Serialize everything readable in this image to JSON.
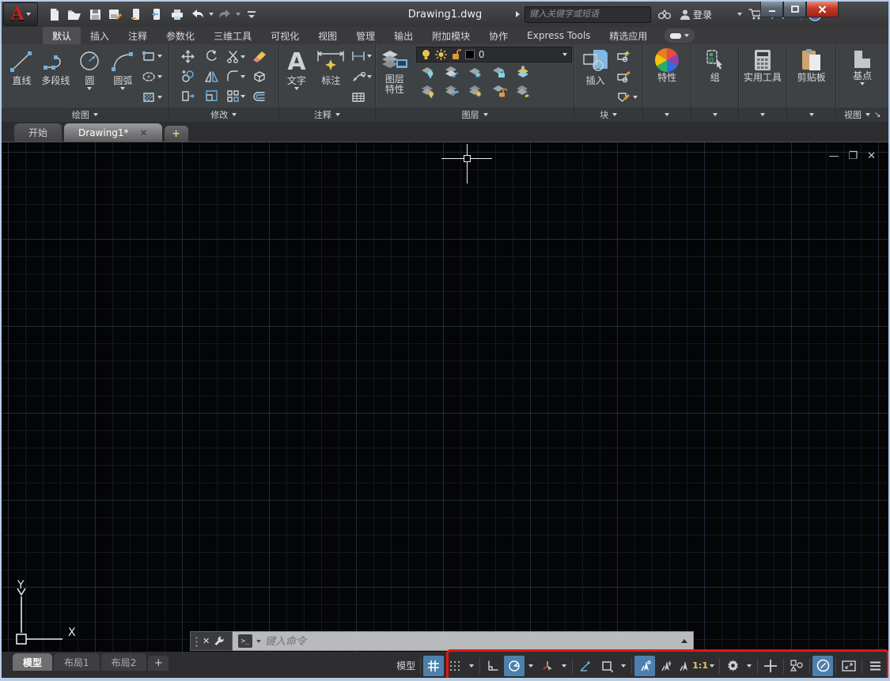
{
  "window": {
    "title": "Drawing1.dwg",
    "search_placeholder": "键入关键字或短语",
    "signin_label": "登录"
  },
  "ribbon": {
    "tabs": [
      "默认",
      "插入",
      "注释",
      "参数化",
      "三维工具",
      "可视化",
      "视图",
      "管理",
      "输出",
      "附加模块",
      "协作",
      "Express Tools",
      "精选应用"
    ],
    "active_tab": "默认",
    "panels": {
      "draw": {
        "label": "绘图",
        "line": "直线",
        "polyline": "多段线",
        "circle": "圆",
        "arc": "圆弧"
      },
      "modify": {
        "label": "修改"
      },
      "annotate": {
        "label": "注释",
        "text": "文字",
        "dimension": "标注"
      },
      "layers": {
        "label": "图层",
        "layer_properties": "图层特性",
        "current_layer": "0"
      },
      "block": {
        "label": "块",
        "insert": "插入"
      },
      "properties": {
        "big": "特性"
      },
      "groups": {
        "big": "组"
      },
      "utilities": {
        "big": "实用工具"
      },
      "clipboard": {
        "big": "剪贴板"
      },
      "view": {
        "label": "视图",
        "big": "基点"
      }
    }
  },
  "file_tabs": {
    "start": "开始",
    "drawing": "Drawing1*"
  },
  "command_line": {
    "placeholder": "键入命令"
  },
  "layout_tabs": {
    "model": "模型",
    "layout1": "布局1",
    "layout2": "布局2"
  },
  "status_bar": {
    "model_label": "模型",
    "annotation_scale": "1:1"
  },
  "ucs": {
    "x_label": "X",
    "y_label": "Y"
  },
  "icons": {
    "qat": [
      "new",
      "open",
      "save",
      "save-as",
      "open-from-mobile",
      "save-to-mobile",
      "plot",
      "undo",
      "redo",
      "qat-customize"
    ],
    "status": [
      "grid",
      "snap",
      "ortho",
      "polar-tracking",
      "isometric-draft",
      "object-snap-tracking",
      "object-snap",
      "annotation-visibility",
      "annotation-autoscale",
      "annotation-scale",
      "workspace-gear",
      "ui-plus",
      "selection-filter-shapes",
      "hardware-acceleration",
      "clean-screen",
      "customize-menu"
    ]
  },
  "colors": {
    "active_blue": "#4d80ad",
    "annotation_red": "#e21712",
    "canvas_bg": "#040507",
    "grid_minor": "#15171d",
    "grid_major": "#242a38"
  }
}
